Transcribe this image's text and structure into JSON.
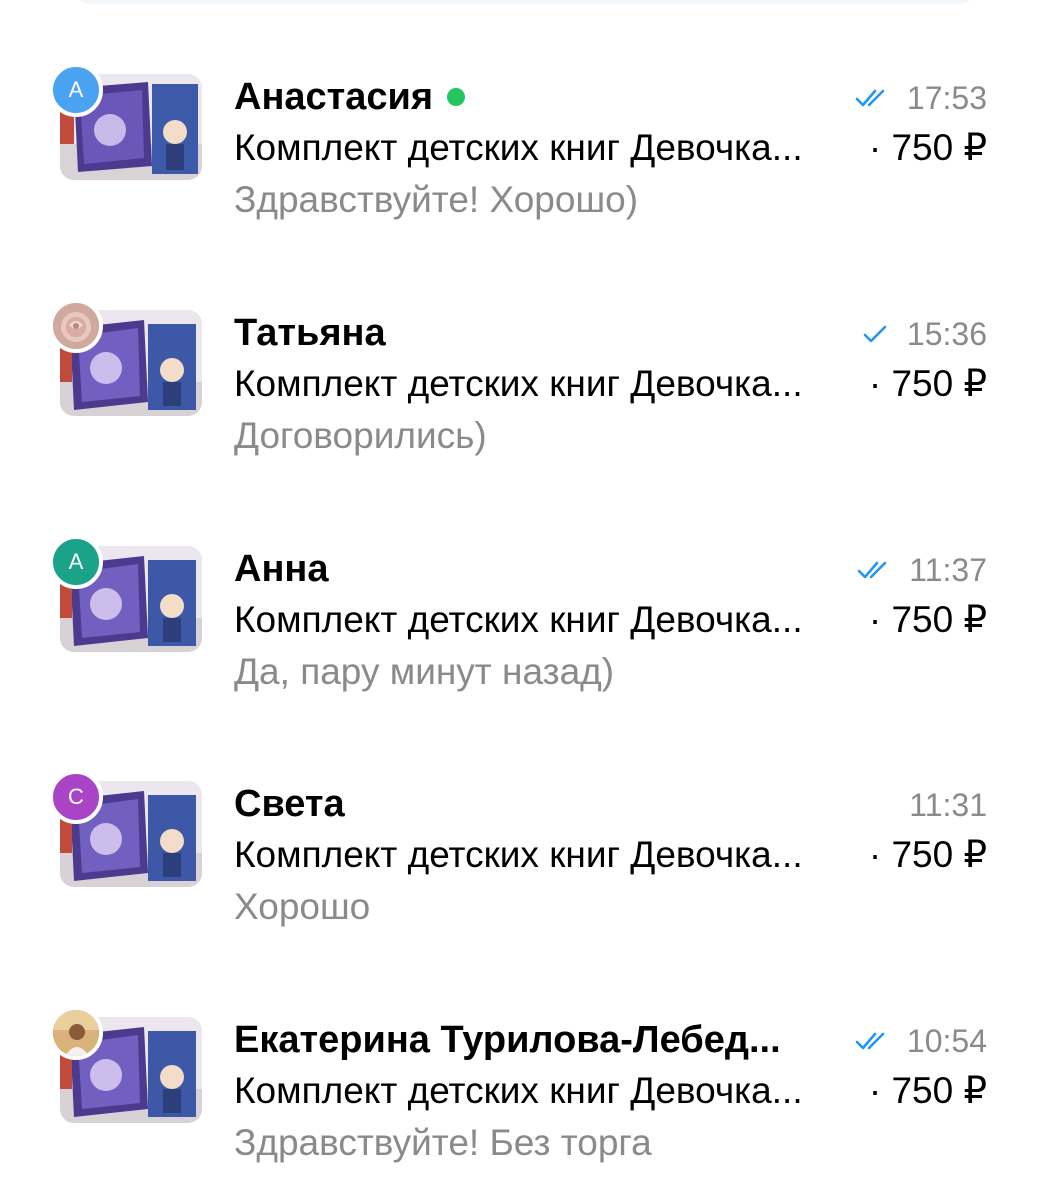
{
  "chats": [
    {
      "name": "Анастасия",
      "online": true,
      "avatar_letter": "А",
      "avatar_color": "#4aa3f0",
      "read_status": "double-check-icon",
      "time": "17:53",
      "product": "Комплект детских книг Девочка...",
      "price": "· 750 ₽",
      "last_message": "Здравствуйте! Хорошо)"
    },
    {
      "name": "Татьяна",
      "online": false,
      "avatar_letter": "",
      "avatar_color": "#d9b8ad",
      "read_status": "single-check-icon",
      "time": "15:36",
      "product": "Комплект детских книг Девочка...",
      "price": "· 750 ₽",
      "last_message": "Договорились)"
    },
    {
      "name": "Анна",
      "online": false,
      "avatar_letter": "А",
      "avatar_color": "#1aa389",
      "read_status": "double-check-icon",
      "time": "11:37",
      "product": "Комплект детских книг Девочка...",
      "price": "· 750 ₽",
      "last_message": "Да, пару минут назад)"
    },
    {
      "name": "Света",
      "online": false,
      "avatar_letter": "С",
      "avatar_color": "#a944c6",
      "read_status": "",
      "time": "11:31",
      "product": "Комплект детских книг Девочка...",
      "price": "· 750 ₽",
      "last_message": "Хорошо"
    },
    {
      "name": "Екатерина Турилова-Лебед...",
      "online": false,
      "avatar_letter": "",
      "avatar_color": "#c9a36a",
      "read_status": "double-check-icon",
      "time": "10:54",
      "product": "Комплект детских книг Девочка...",
      "price": "· 750 ₽",
      "last_message": "Здравствуйте! Без торга"
    }
  ],
  "colors": {
    "check": "#2196f3",
    "online": "#22c55e",
    "secondary_text": "#8a8a8a"
  }
}
